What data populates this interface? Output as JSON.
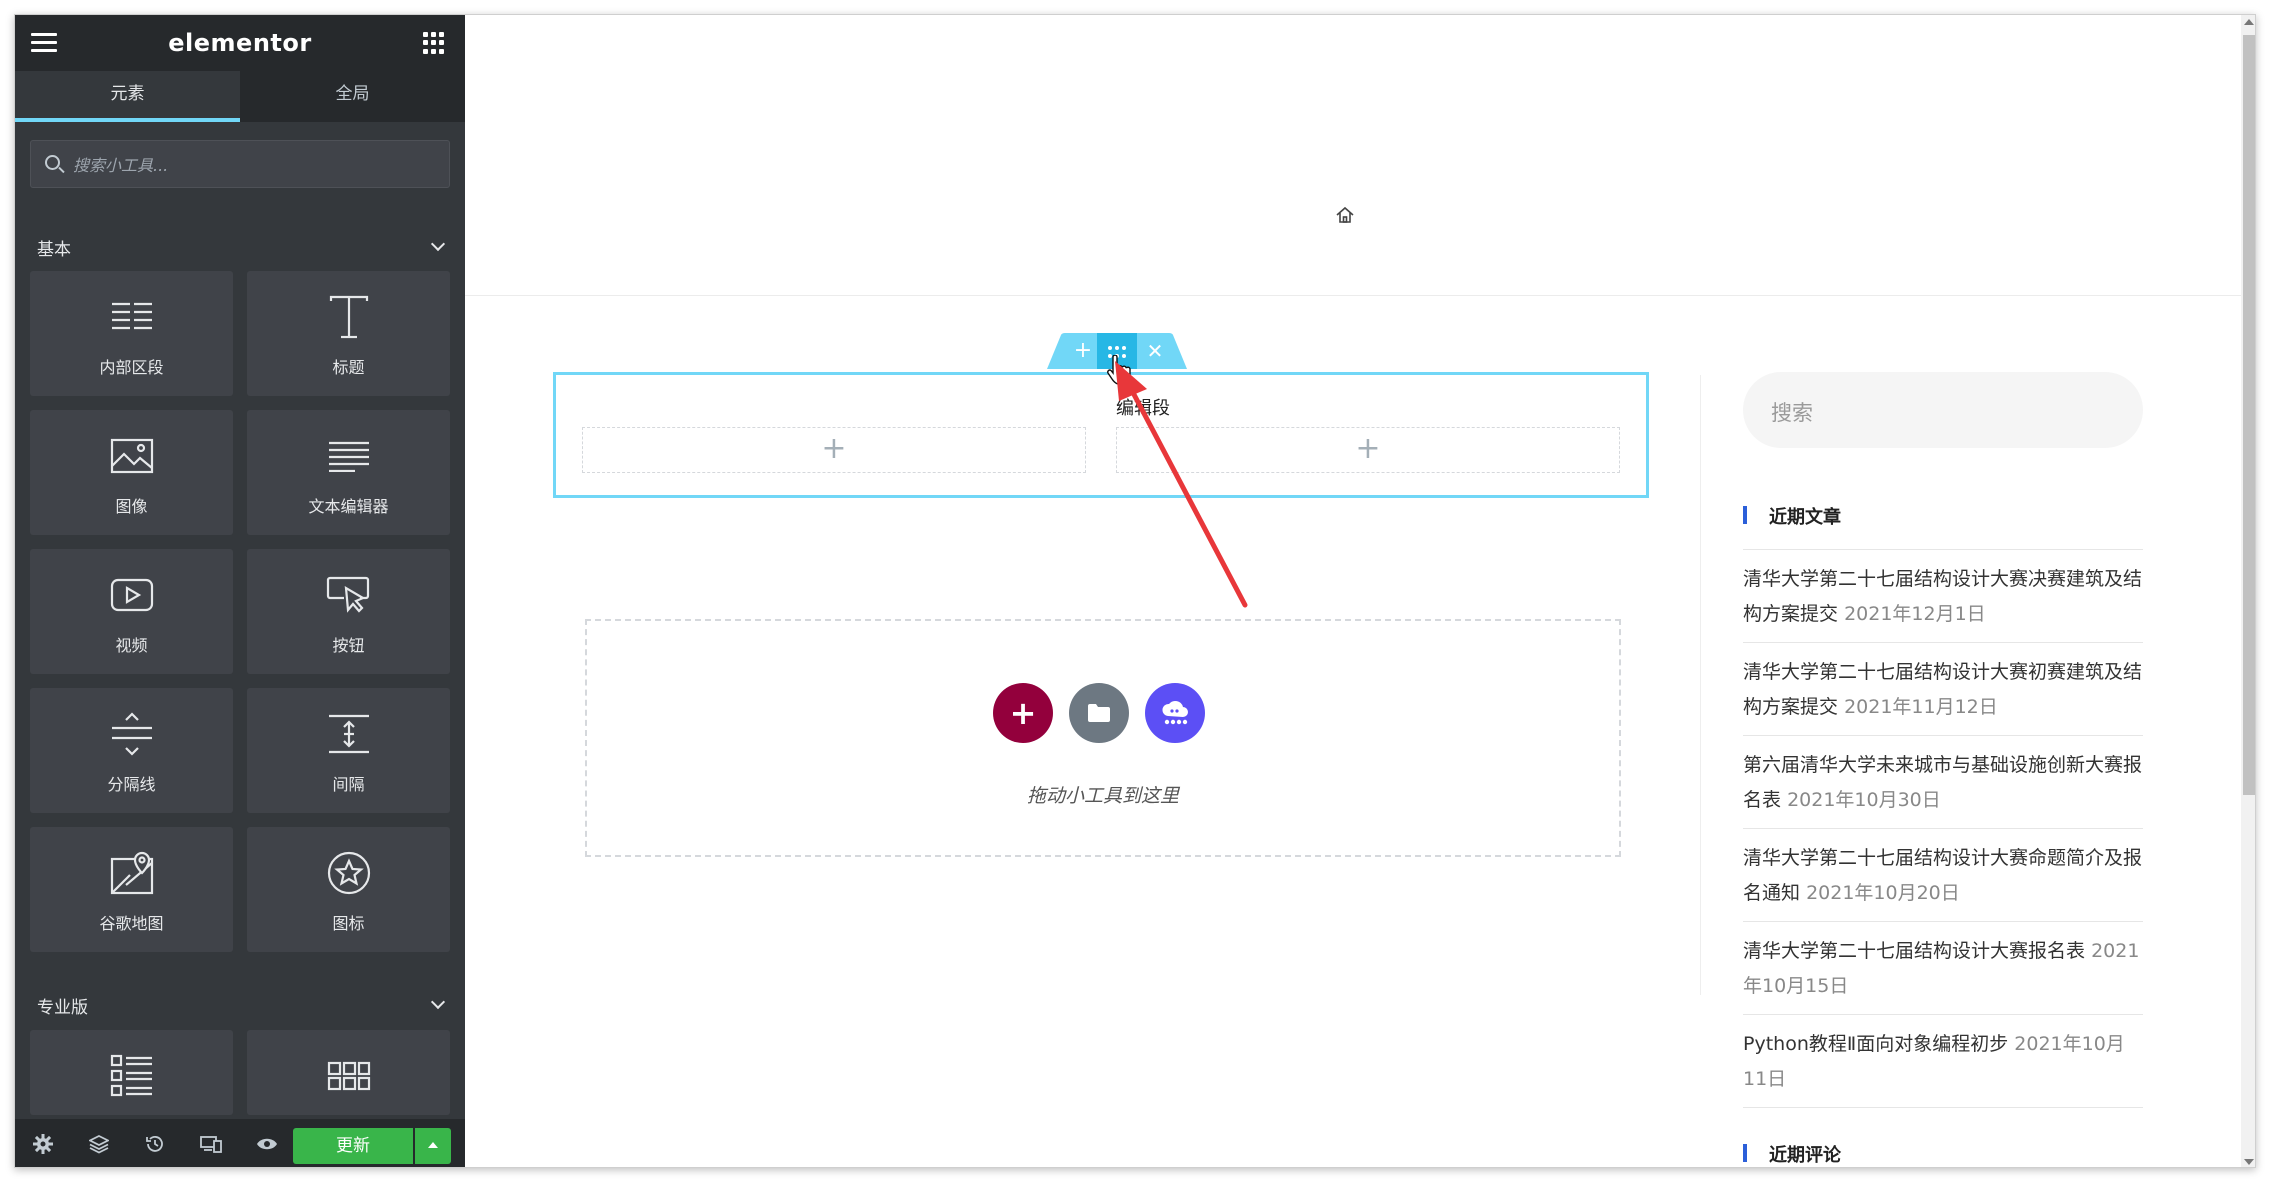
{
  "app": {
    "logo": "elementor"
  },
  "tabs": [
    {
      "label": "元素"
    },
    {
      "label": "全局"
    }
  ],
  "search": {
    "placeholder": "搜索小工具..."
  },
  "categories": {
    "basic": "基本",
    "pro": "专业版"
  },
  "widgets": [
    {
      "label": "内部区段",
      "icon": "inner-section-icon"
    },
    {
      "label": "标题",
      "icon": "heading-icon"
    },
    {
      "label": "图像",
      "icon": "image-icon"
    },
    {
      "label": "文本编辑器",
      "icon": "text-editor-icon"
    },
    {
      "label": "视频",
      "icon": "video-icon"
    },
    {
      "label": "按钮",
      "icon": "button-icon"
    },
    {
      "label": "分隔线",
      "icon": "divider-icon"
    },
    {
      "label": "间隔",
      "icon": "spacer-icon"
    },
    {
      "label": "谷歌地图",
      "icon": "google-maps-icon"
    },
    {
      "label": "图标",
      "icon": "star-icon"
    }
  ],
  "pro_widgets": [
    {
      "icon": "posts-icon"
    },
    {
      "icon": "portfolio-icon"
    }
  ],
  "footer": {
    "update_label": "更新"
  },
  "canvas": {
    "tooltip": "编辑段",
    "drop_text": "拖动小工具到这里",
    "add_color": "#93003c",
    "folder_color": "#6d7882",
    "kit_color": "#5c4ff5",
    "accent": "#71d7f7"
  },
  "sidebar": {
    "search_placeholder": "搜索",
    "recent_posts_title": "近期文章",
    "recent_comments_title": "近期评论",
    "posts": [
      {
        "title": "清华大学第二十七届结构设计大赛决赛建筑及结构方案提交",
        "date": "2021年12月1日"
      },
      {
        "title": "清华大学第二十七届结构设计大赛初赛建筑及结构方案提交",
        "date": "2021年11月12日"
      },
      {
        "title": "第六届清华大学未来城市与基础设施创新大赛报名表",
        "date": "2021年10月30日"
      },
      {
        "title": "清华大学第二十七届结构设计大赛命题简介及报名通知",
        "date": "2021年10月20日"
      },
      {
        "title": "清华大学第二十七届结构设计大赛报名表",
        "date": "2021年10月15日"
      },
      {
        "title": "Python教程Ⅱ面向对象编程初步",
        "date": "2021年10月11日"
      }
    ]
  }
}
